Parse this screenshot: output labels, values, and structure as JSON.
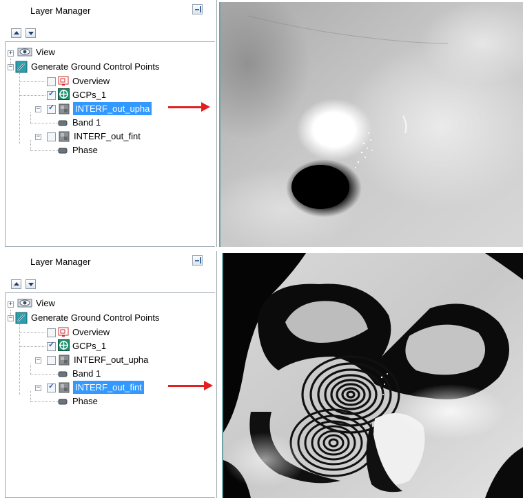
{
  "panels": [
    {
      "layer_manager": {
        "title": "Layer Manager",
        "tree": [
          {
            "label": "View"
          },
          {
            "label": "Generate Ground Control Points"
          },
          {
            "label": "Overview",
            "checked": false
          },
          {
            "label": "GCPs_1",
            "checked": true
          },
          {
            "label": "INTERF_out_upha",
            "checked": true,
            "selected": true
          },
          {
            "label": "Band 1"
          },
          {
            "label": "INTERF_out_fint",
            "checked": false
          },
          {
            "label": "Phase"
          }
        ]
      },
      "view_image": "unwrapped-phase-grayscale"
    },
    {
      "layer_manager": {
        "title": "Layer Manager",
        "tree": [
          {
            "label": "View"
          },
          {
            "label": "Generate Ground Control Points"
          },
          {
            "label": "Overview",
            "checked": false
          },
          {
            "label": "GCPs_1",
            "checked": true
          },
          {
            "label": "INTERF_out_upha",
            "checked": false
          },
          {
            "label": "Band 1"
          },
          {
            "label": "INTERF_out_fint",
            "checked": true,
            "selected": true
          },
          {
            "label": "Phase"
          }
        ]
      },
      "view_image": "wrapped-interferogram-fringes"
    }
  ],
  "annotation_color": "#e32020",
  "selection_color": "#3399ff"
}
